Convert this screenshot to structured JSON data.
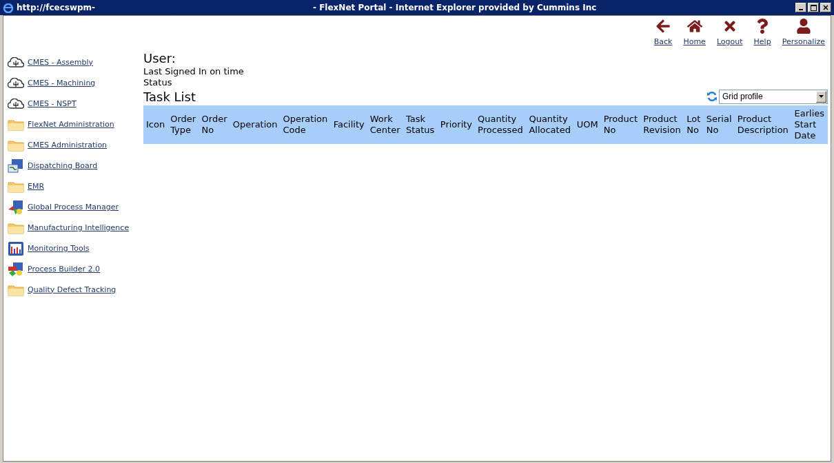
{
  "window": {
    "url": "http://fcecswpm-",
    "title": "- FlexNet Portal - Internet Explorer provided by Cummins Inc"
  },
  "toolbar": [
    {
      "kind": "back",
      "label": "Back"
    },
    {
      "kind": "home",
      "label": "Home"
    },
    {
      "kind": "logout",
      "label": "Logout"
    },
    {
      "kind": "help",
      "label": "Help"
    },
    {
      "kind": "person",
      "label": "Personalize"
    }
  ],
  "sidebar": {
    "items": [
      {
        "kind": "cloud",
        "label": "CMES - Assembly"
      },
      {
        "kind": "cloud",
        "label": "CMES - Machining"
      },
      {
        "kind": "cloud",
        "label": "CMES - NSPT"
      },
      {
        "kind": "folder",
        "label": "FlexNet Administration"
      },
      {
        "kind": "folder",
        "label": "CMES Administration"
      },
      {
        "kind": "board",
        "label": "Dispatching Board"
      },
      {
        "kind": "folder",
        "label": "EMR"
      },
      {
        "kind": "process",
        "label": "Global Process Manager"
      },
      {
        "kind": "folder",
        "label": "Manufacturing Intelligence"
      },
      {
        "kind": "chart",
        "label": "Monitoring Tools"
      },
      {
        "kind": "builder",
        "label": "Process Builder 2.0"
      },
      {
        "kind": "folder",
        "label": "Quality Defect Tracking"
      }
    ]
  },
  "user": {
    "heading": "User:",
    "last_signed_in": "Last Signed In on time",
    "status": "Status"
  },
  "task_list": {
    "title": "Task List",
    "grid_profile": "Grid profile",
    "columns": [
      "Icon",
      "Order Type",
      "Order No",
      "Operation",
      "Operation Code",
      "Facility",
      "Work Center",
      "Task Status",
      "Priority",
      "Quantity Processed",
      "Quantity Allocated",
      "UOM",
      "Product No",
      "Product Revision",
      "Lot No",
      "Serial No",
      "Product Description",
      "Earlies Start Date"
    ]
  }
}
